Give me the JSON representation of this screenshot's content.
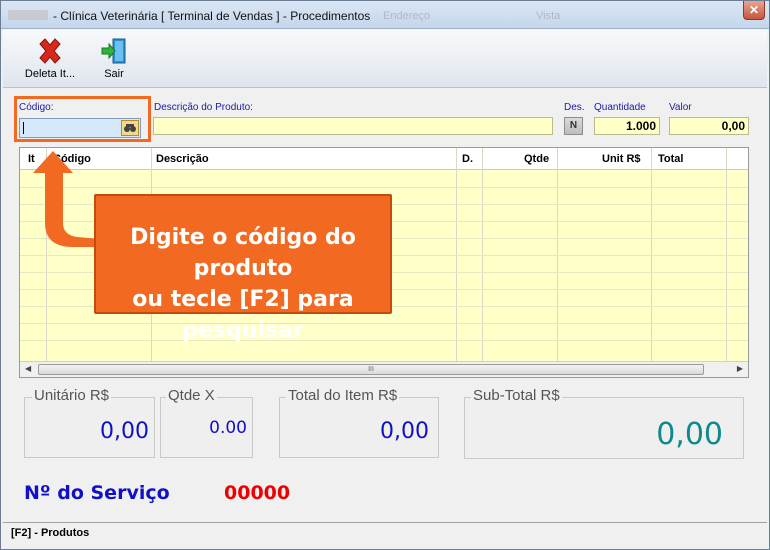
{
  "window": {
    "title": "- Clínica Veterinária [ Terminal de Vendas ] - Procedimentos",
    "ghost_text_1": "Endereço",
    "ghost_text_2": "Vista"
  },
  "toolbar": {
    "delete_label": "Deleta It...",
    "exit_label": "Sair"
  },
  "form": {
    "code_label": "Código:",
    "code_value": "",
    "description_label": "Descrição do  Produto:",
    "description_value": "",
    "des_label": "Des.",
    "des_button": "N",
    "quantity_label": "Quantidade",
    "quantity_value": "1.000",
    "value_label": "Valor",
    "value_value": "0,00"
  },
  "grid": {
    "columns": [
      "It",
      "Código",
      "Descrição",
      "D.",
      "Qtde",
      "Unit R$",
      "Total"
    ],
    "rows": []
  },
  "callout": {
    "line1": "Digite o código do produto",
    "line2": "ou tecle [F2] para pesquisar"
  },
  "totals": {
    "unit_label": "Unitário R$",
    "unit_value": "0,00",
    "qty_label": "Qtde X",
    "qty_value": "0.00",
    "item_total_label": "Total do Item R$",
    "item_total_value": "0,00",
    "subtotal_label": "Sub-Total R$",
    "subtotal_value": "0,00",
    "subtotal_color": "#0f8a8a",
    "value_color": "#1010c8"
  },
  "service": {
    "label": "Nº do Serviço",
    "number": "00000"
  },
  "status": {
    "text": "[F2] - Produtos"
  }
}
